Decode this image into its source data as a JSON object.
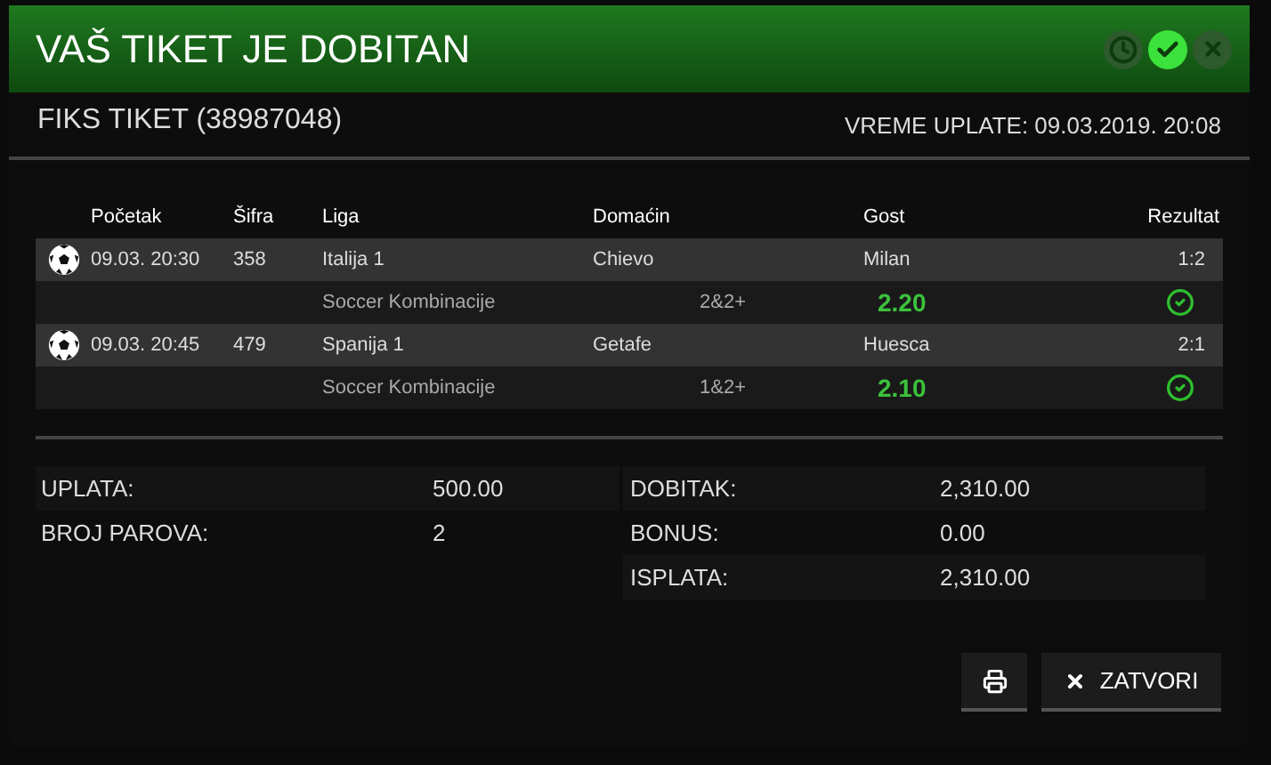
{
  "dialog": {
    "title": "VAŠ TIKET JE DOBITAN",
    "status_icons": [
      {
        "kind": "pending",
        "selected": false
      },
      {
        "kind": "won",
        "selected": true
      },
      {
        "kind": "lost",
        "selected": false
      }
    ],
    "ticket_title": "FIKS TIKET (38987048)",
    "payment_time": "VREME UPLATE: 09.03.2019. 20:08"
  },
  "table": {
    "columns": [
      "Početak",
      "Šifra",
      "Liga",
      "Domaćin",
      "Gost",
      "Rezultat"
    ],
    "rows": [
      {
        "start": "09.03. 20:30",
        "code": "358",
        "league": "Italija 1",
        "home": "Chievo",
        "away": "Milan",
        "result": "1:2",
        "market": "Soccer Kombinacije",
        "pick": "2&2+",
        "odds": "2.20",
        "won": true
      },
      {
        "start": "09.03. 20:45",
        "code": "479",
        "league": "Spanija 1",
        "home": "Getafe",
        "away": "Huesca",
        "result": "2:1",
        "market": "Soccer Kombinacije",
        "pick": "1&2+",
        "odds": "2.10",
        "won": true
      }
    ]
  },
  "summary_left": [
    {
      "label": "UPLATA:",
      "value": "500.00"
    },
    {
      "label": "BROJ PAROVA:",
      "value": "2"
    }
  ],
  "summary_right": [
    {
      "label": "DOBITAK:",
      "value": "2,310.00"
    },
    {
      "label": "BONUS:",
      "value": "0.00"
    },
    {
      "label": "ISPLATA:",
      "value": "2,310.00"
    }
  ],
  "buttons": {
    "close": "ZATVORI"
  }
}
